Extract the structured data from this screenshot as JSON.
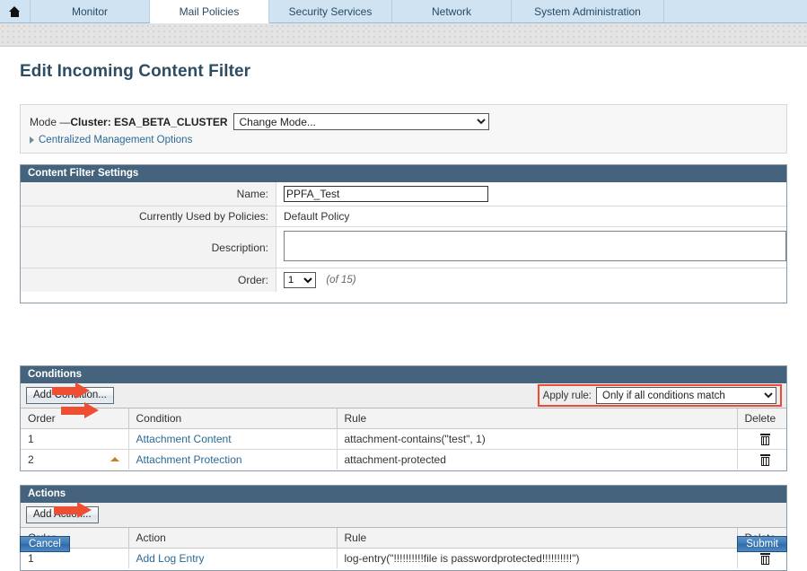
{
  "nav": {
    "home_icon": "home-icon",
    "tabs": [
      {
        "label": "Monitor",
        "active": false
      },
      {
        "label": "Mail Policies",
        "active": true
      },
      {
        "label": "Security Services",
        "active": false
      },
      {
        "label": "Network",
        "active": false
      },
      {
        "label": "System Administration",
        "active": false
      }
    ]
  },
  "page": {
    "title": "Edit Incoming Content Filter"
  },
  "mode_bar": {
    "mode_prefix": "Mode —",
    "mode_value": "Cluster: ESA_BETA_CLUSTER",
    "change_mode_selected": "Change Mode...",
    "centralized_management_link": "Centralized Management Options",
    "disclosure_icon": "triangle-right-icon"
  },
  "settings": {
    "header": "Content Filter Settings",
    "rows": {
      "name_label": "Name:",
      "name_value": "PPFA_Test",
      "policies_label": "Currently Used by Policies:",
      "policies_value": "Default Policy",
      "description_label": "Description:",
      "description_value": "",
      "order_label": "Order:",
      "order_value": "1",
      "order_note": "(of 15)"
    }
  },
  "conditions": {
    "header": "Conditions",
    "add_button": "Add Condition...",
    "apply_rule_label": "Apply rule:",
    "apply_rule_value": "Only if all conditions match",
    "columns": [
      "Order",
      "Condition",
      "Rule",
      "Delete"
    ],
    "rows": [
      {
        "order": "1",
        "name": "Attachment Content",
        "rule": "attachment-contains(\"test\", 1)",
        "delete_icon": "trash-icon",
        "sort_icon": ""
      },
      {
        "order": "2",
        "name": "Attachment Protection",
        "rule": "attachment-protected",
        "delete_icon": "trash-icon",
        "sort_icon": "sort-up-icon"
      }
    ]
  },
  "actions": {
    "header": "Actions",
    "add_button": "Add Action...",
    "columns": [
      "Order",
      "Action",
      "Rule",
      "Delete"
    ],
    "rows": [
      {
        "order": "1",
        "name": "Add Log Entry",
        "rule": "log-entry(\"!!!!!!!!!!file is passwordprotected!!!!!!!!!!\")",
        "delete_icon": "trash-icon"
      }
    ]
  },
  "footer": {
    "cancel_label": "Cancel",
    "submit_label": "Submit"
  },
  "colors": {
    "panel_header": "#46637d",
    "accent_link": "#2b6a96",
    "annotation_red": "#ee4f33",
    "nav_background": "#cfe3f2",
    "submit_blue": "#3a78b5",
    "sort_triangle": "#c4832a"
  }
}
